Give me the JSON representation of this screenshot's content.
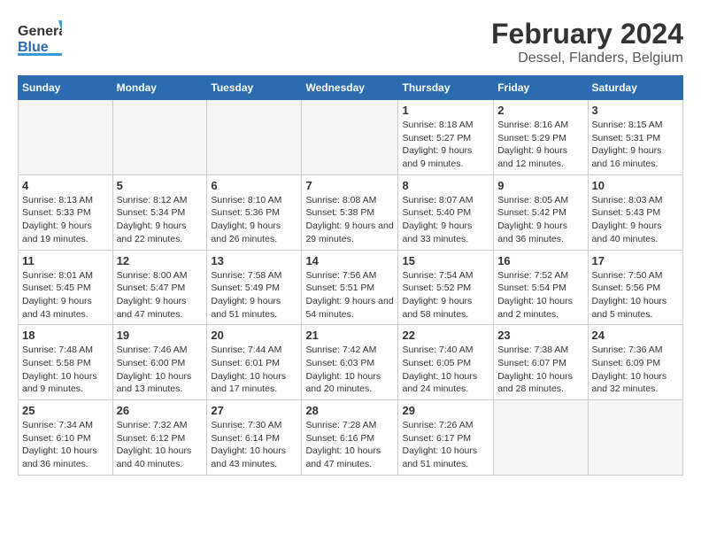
{
  "header": {
    "logo_general": "General",
    "logo_blue": "Blue",
    "month_year": "February 2024",
    "location": "Dessel, Flanders, Belgium"
  },
  "weekdays": [
    "Sunday",
    "Monday",
    "Tuesday",
    "Wednesday",
    "Thursday",
    "Friday",
    "Saturday"
  ],
  "weeks": [
    [
      {
        "day": "",
        "empty": true
      },
      {
        "day": "",
        "empty": true
      },
      {
        "day": "",
        "empty": true
      },
      {
        "day": "",
        "empty": true
      },
      {
        "day": "1",
        "sunrise": "8:18 AM",
        "sunset": "5:27 PM",
        "daylight": "9 hours and 9 minutes."
      },
      {
        "day": "2",
        "sunrise": "8:16 AM",
        "sunset": "5:29 PM",
        "daylight": "9 hours and 12 minutes."
      },
      {
        "day": "3",
        "sunrise": "8:15 AM",
        "sunset": "5:31 PM",
        "daylight": "9 hours and 16 minutes."
      }
    ],
    [
      {
        "day": "4",
        "sunrise": "8:13 AM",
        "sunset": "5:33 PM",
        "daylight": "9 hours and 19 minutes."
      },
      {
        "day": "5",
        "sunrise": "8:12 AM",
        "sunset": "5:34 PM",
        "daylight": "9 hours and 22 minutes."
      },
      {
        "day": "6",
        "sunrise": "8:10 AM",
        "sunset": "5:36 PM",
        "daylight": "9 hours and 26 minutes."
      },
      {
        "day": "7",
        "sunrise": "8:08 AM",
        "sunset": "5:38 PM",
        "daylight": "9 hours and 29 minutes."
      },
      {
        "day": "8",
        "sunrise": "8:07 AM",
        "sunset": "5:40 PM",
        "daylight": "9 hours and 33 minutes."
      },
      {
        "day": "9",
        "sunrise": "8:05 AM",
        "sunset": "5:42 PM",
        "daylight": "9 hours and 36 minutes."
      },
      {
        "day": "10",
        "sunrise": "8:03 AM",
        "sunset": "5:43 PM",
        "daylight": "9 hours and 40 minutes."
      }
    ],
    [
      {
        "day": "11",
        "sunrise": "8:01 AM",
        "sunset": "5:45 PM",
        "daylight": "9 hours and 43 minutes."
      },
      {
        "day": "12",
        "sunrise": "8:00 AM",
        "sunset": "5:47 PM",
        "daylight": "9 hours and 47 minutes."
      },
      {
        "day": "13",
        "sunrise": "7:58 AM",
        "sunset": "5:49 PM",
        "daylight": "9 hours and 51 minutes."
      },
      {
        "day": "14",
        "sunrise": "7:56 AM",
        "sunset": "5:51 PM",
        "daylight": "9 hours and 54 minutes."
      },
      {
        "day": "15",
        "sunrise": "7:54 AM",
        "sunset": "5:52 PM",
        "daylight": "9 hours and 58 minutes."
      },
      {
        "day": "16",
        "sunrise": "7:52 AM",
        "sunset": "5:54 PM",
        "daylight": "10 hours and 2 minutes."
      },
      {
        "day": "17",
        "sunrise": "7:50 AM",
        "sunset": "5:56 PM",
        "daylight": "10 hours and 5 minutes."
      }
    ],
    [
      {
        "day": "18",
        "sunrise": "7:48 AM",
        "sunset": "5:58 PM",
        "daylight": "10 hours and 9 minutes."
      },
      {
        "day": "19",
        "sunrise": "7:46 AM",
        "sunset": "6:00 PM",
        "daylight": "10 hours and 13 minutes."
      },
      {
        "day": "20",
        "sunrise": "7:44 AM",
        "sunset": "6:01 PM",
        "daylight": "10 hours and 17 minutes."
      },
      {
        "day": "21",
        "sunrise": "7:42 AM",
        "sunset": "6:03 PM",
        "daylight": "10 hours and 20 minutes."
      },
      {
        "day": "22",
        "sunrise": "7:40 AM",
        "sunset": "6:05 PM",
        "daylight": "10 hours and 24 minutes."
      },
      {
        "day": "23",
        "sunrise": "7:38 AM",
        "sunset": "6:07 PM",
        "daylight": "10 hours and 28 minutes."
      },
      {
        "day": "24",
        "sunrise": "7:36 AM",
        "sunset": "6:09 PM",
        "daylight": "10 hours and 32 minutes."
      }
    ],
    [
      {
        "day": "25",
        "sunrise": "7:34 AM",
        "sunset": "6:10 PM",
        "daylight": "10 hours and 36 minutes."
      },
      {
        "day": "26",
        "sunrise": "7:32 AM",
        "sunset": "6:12 PM",
        "daylight": "10 hours and 40 minutes."
      },
      {
        "day": "27",
        "sunrise": "7:30 AM",
        "sunset": "6:14 PM",
        "daylight": "10 hours and 43 minutes."
      },
      {
        "day": "28",
        "sunrise": "7:28 AM",
        "sunset": "6:16 PM",
        "daylight": "10 hours and 47 minutes."
      },
      {
        "day": "29",
        "sunrise": "7:26 AM",
        "sunset": "6:17 PM",
        "daylight": "10 hours and 51 minutes."
      },
      {
        "day": "",
        "empty": true
      },
      {
        "day": "",
        "empty": true
      }
    ]
  ]
}
